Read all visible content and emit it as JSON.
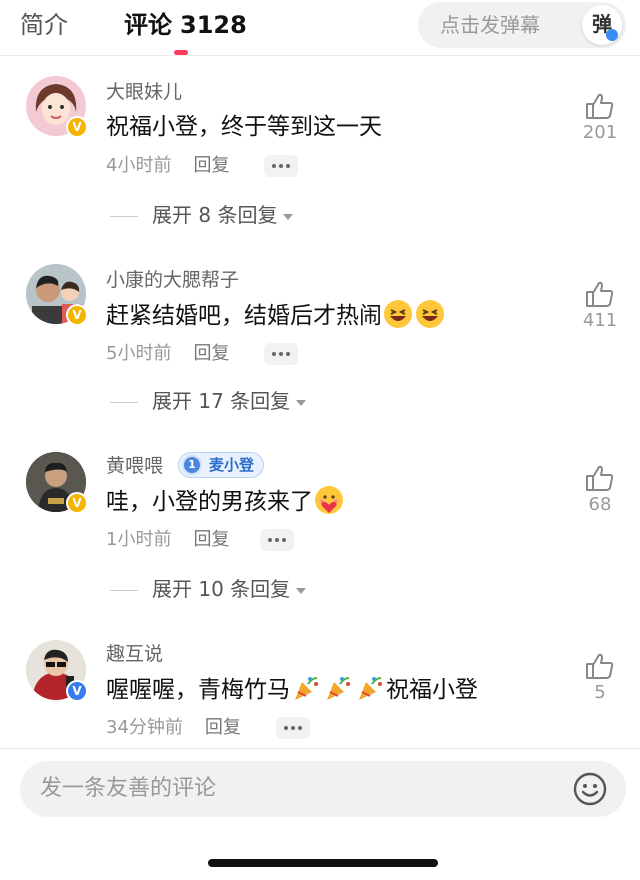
{
  "tabs": {
    "intro": "简介",
    "comments": "评论",
    "comment_count": "3128"
  },
  "danmaku": {
    "placeholder": "点击发弹幕",
    "button": "弹"
  },
  "comments": [
    {
      "user": "大眼妹儿",
      "text": "祝福小登，终于等到这一天",
      "time": "4小时前",
      "reply": "回复",
      "likes": "201",
      "expand": "展开 8 条回复",
      "badge": "V"
    },
    {
      "user": "小康的大腮帮子",
      "text": "赶紧结婚吧，结婚后才热闹",
      "time": "5小时前",
      "reply": "回复",
      "likes": "411",
      "expand": "展开 17 条回复",
      "badge": "V",
      "emojis": [
        "laugh-emoji",
        "laugh-emoji"
      ]
    },
    {
      "user": "黄喂喂",
      "fan_badge_level": "1",
      "fan_badge_name": "麦小登",
      "text": "哇，小登的男孩来了",
      "time": "1小时前",
      "reply": "回复",
      "likes": "68",
      "expand": "展开 10 条回复",
      "badge": "V",
      "emojis": [
        "heart-hug-emoji"
      ]
    },
    {
      "user": "趣互说",
      "text_a": "喔喔喔，青梅竹马",
      "text_b": "祝福小登",
      "time": "34分钟前",
      "reply": "回复",
      "likes": "5",
      "badge": "V",
      "emojis": [
        "party-popper-emoji",
        "party-popper-emoji",
        "party-popper-emoji"
      ]
    }
  ],
  "input": {
    "placeholder": "发一条友善的评论"
  },
  "colors": {
    "accent": "#fb3b5a",
    "gold_badge": "#f5b400",
    "blue_badge": "#3a7bf0",
    "muted_text": "#999999"
  }
}
